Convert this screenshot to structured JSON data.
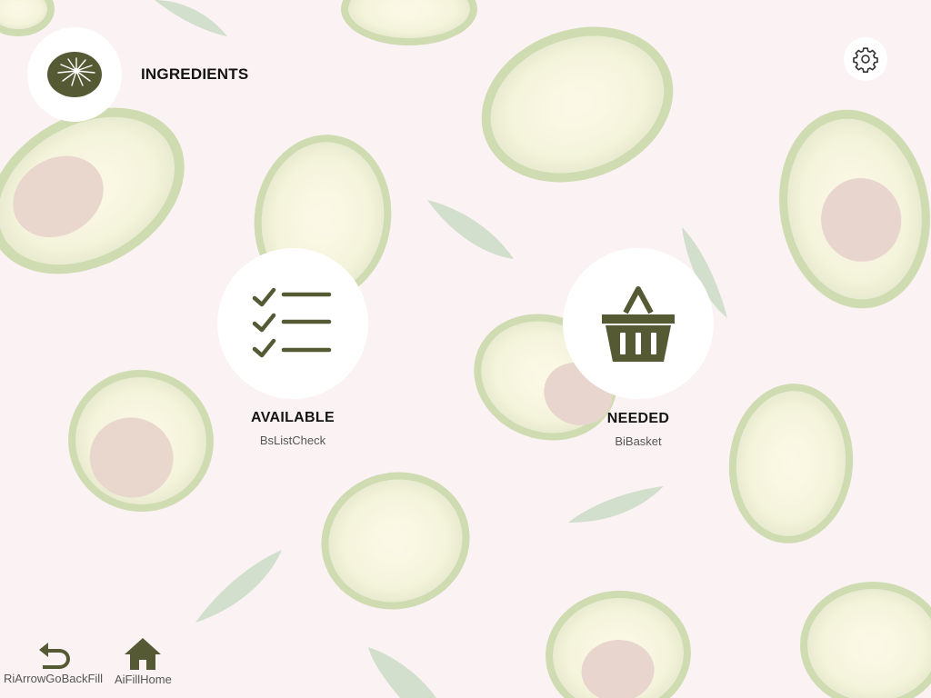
{
  "header": {
    "logo_icon": "avocado-logo-icon",
    "title": "INGREDIENTS",
    "settings_icon": "gear-icon"
  },
  "cards": [
    {
      "label": "AVAILABLE",
      "icon_name": "BsListCheck"
    },
    {
      "label": "NEEDED",
      "icon_name": "BiBasket"
    }
  ],
  "bottom_nav": [
    {
      "label": "RiArrowGoBackFill"
    },
    {
      "label": "AiFillHome"
    }
  ],
  "colors": {
    "accent": "#555a35",
    "background": "#fbf3f3",
    "circle": "#ffffff"
  }
}
